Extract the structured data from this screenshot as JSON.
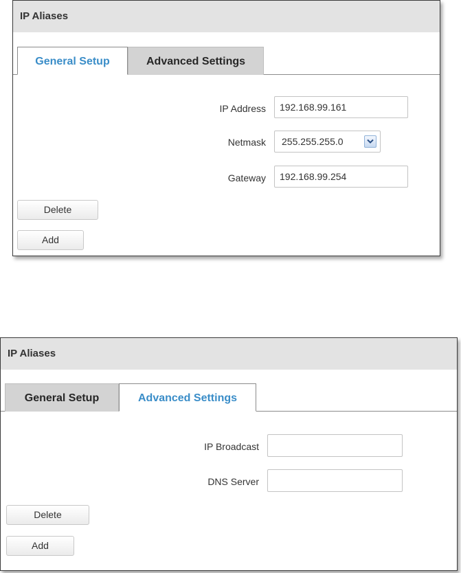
{
  "panels": [
    {
      "title": "IP Aliases",
      "tabs": [
        {
          "label": "General Setup",
          "active": true
        },
        {
          "label": "Advanced Settings",
          "active": false
        }
      ],
      "fields": {
        "ip_address": {
          "label": "IP Address",
          "value": "192.168.99.161"
        },
        "netmask": {
          "label": "Netmask",
          "value": "255.255.255.0"
        },
        "gateway": {
          "label": "Gateway",
          "value": "192.168.99.254"
        }
      },
      "buttons": {
        "delete": "Delete",
        "add": "Add"
      }
    },
    {
      "title": "IP Aliases",
      "tabs": [
        {
          "label": "General Setup",
          "active": false
        },
        {
          "label": "Advanced Settings",
          "active": true
        }
      ],
      "fields": {
        "ip_broadcast": {
          "label": "IP Broadcast",
          "value": ""
        },
        "dns_server": {
          "label": "DNS Server",
          "value": ""
        }
      },
      "buttons": {
        "delete": "Delete",
        "add": "Add"
      }
    }
  ],
  "colors": {
    "active_tab_text": "#3a8dc8",
    "header_bg": "#e3e3e3",
    "inactive_tab_bg": "#d3d3d3"
  },
  "icons": {
    "netmask_dropdown": "chevron-down-icon"
  }
}
